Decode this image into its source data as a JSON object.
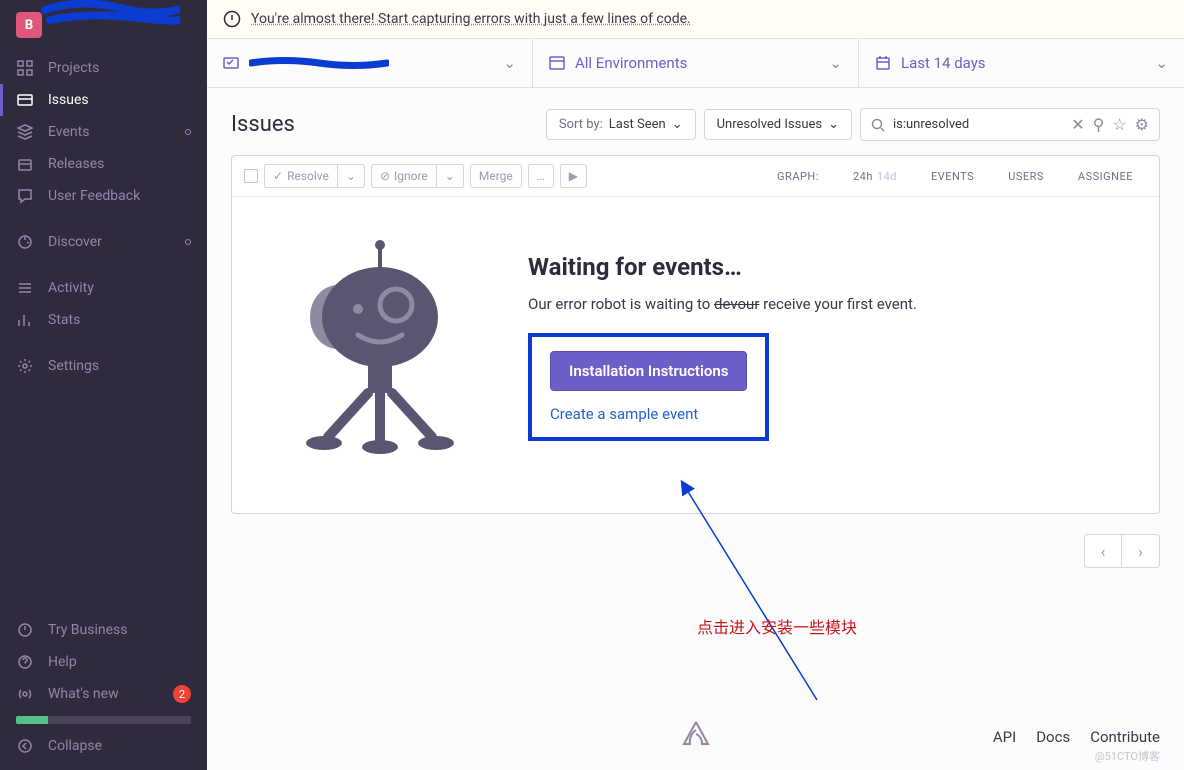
{
  "org": {
    "avatar_letter": "B"
  },
  "sidebar": {
    "items": [
      {
        "label": "Projects"
      },
      {
        "label": "Issues"
      },
      {
        "label": "Events"
      },
      {
        "label": "Releases"
      },
      {
        "label": "User Feedback"
      },
      {
        "label": "Discover"
      },
      {
        "label": "Activity"
      },
      {
        "label": "Stats"
      },
      {
        "label": "Settings"
      }
    ],
    "footer": {
      "try_business": "Try Business",
      "help": "Help",
      "whats_new": "What's new",
      "whats_new_count": "2",
      "collapse": "Collapse"
    }
  },
  "banner": {
    "text": "You're almost there! Start capturing errors with just a few lines of code."
  },
  "filters": {
    "environments": "All Environments",
    "date": "Last 14 days"
  },
  "page": {
    "title": "Issues"
  },
  "controls": {
    "sort_label": "Sort by:",
    "sort_value": "Last Seen",
    "filter_value": "Unresolved Issues",
    "search_value": "is:unresolved"
  },
  "toolbar": {
    "resolve": "Resolve",
    "ignore": "Ignore",
    "merge": "Merge",
    "more": "…",
    "graph": "GRAPH:",
    "t24h": "24h",
    "t14d": "14d",
    "events": "EVENTS",
    "users": "USERS",
    "assignee": "ASSIGNEE"
  },
  "empty": {
    "title": "Waiting for events…",
    "text_before": "Our error robot is waiting to ",
    "text_strike": "devour",
    "text_after": " receive your first event.",
    "cta": "Installation Instructions",
    "sample": "Create a sample event"
  },
  "annotation": {
    "text": "点击进入安装一些模块"
  },
  "footer_links": {
    "api": "API",
    "docs": "Docs",
    "contribute": "Contribute"
  },
  "watermark": "@51CTO博客"
}
